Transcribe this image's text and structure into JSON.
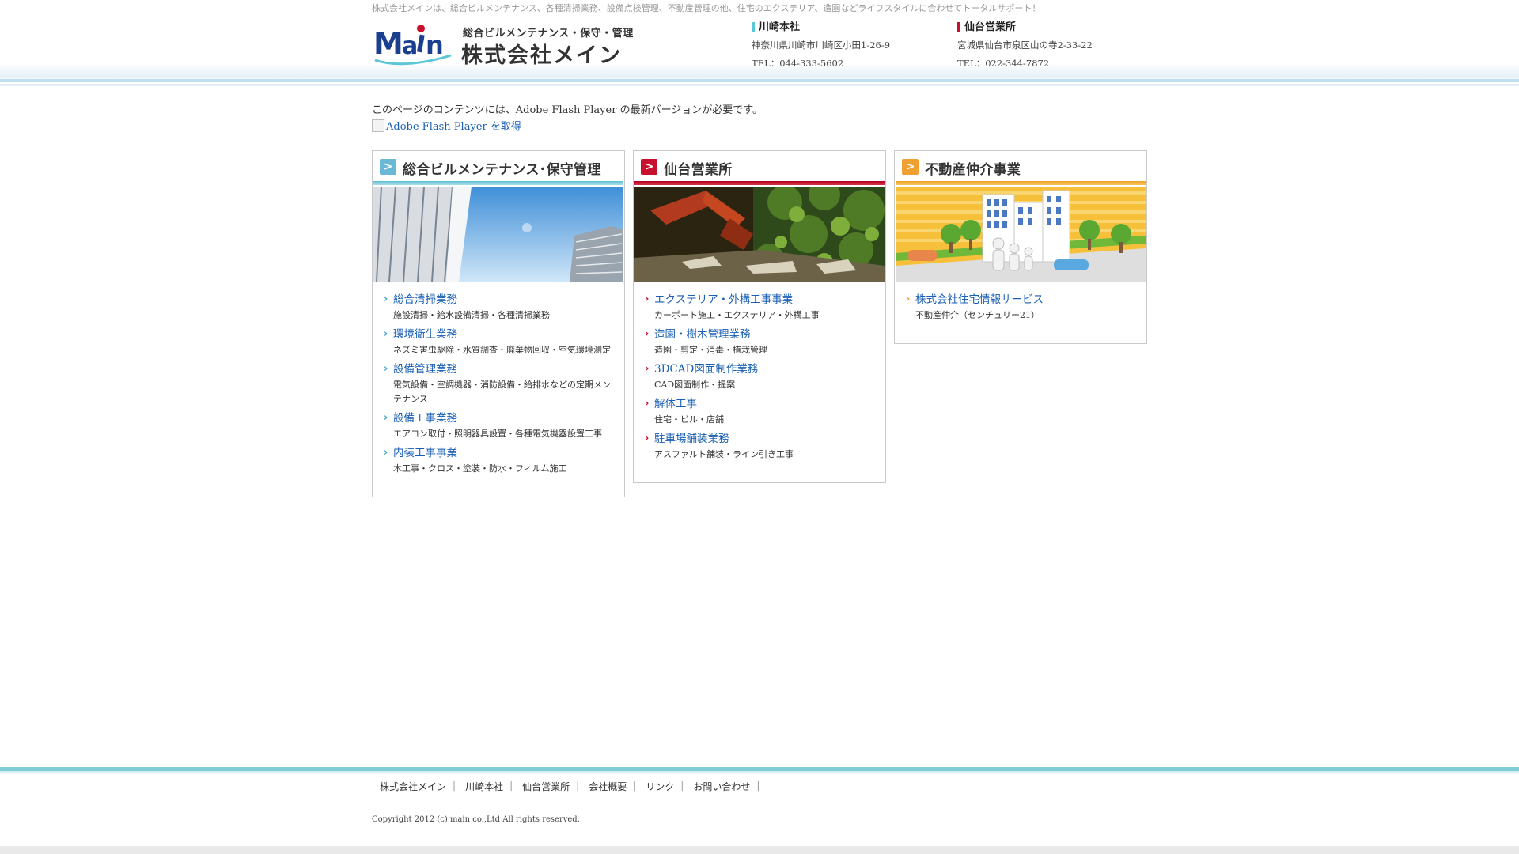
{
  "header": {
    "tagline": "株式会社メインは、総合ビルメンテナンス、各種清掃業務、設備点検管理、不動産管理の他、住宅のエクステリア、造園などライフスタイルに合わせてトータルサポート！",
    "logo_mark_text": "Main",
    "logo_subtitle": "総合ビルメンテナンス・保守・管理",
    "logo_name": "株式会社メイン"
  },
  "offices": [
    {
      "title": "川崎本社",
      "address": "神奈川県川崎市川崎区小田1-26-9",
      "tel": "TEL：044-333-5602",
      "accent": "#5ac6d6"
    },
    {
      "title": "仙台営業所",
      "address": "宮城県仙台市泉区山の寺2-33-22",
      "tel": "TEL：022-344-7872",
      "accent": "#c8102e"
    }
  ],
  "flash": {
    "notice": "このページのコンテンツには、Adobe Flash Player の最新バージョンが必要です。",
    "link_text": "Adobe Flash Player を取得"
  },
  "sections": [
    {
      "title": "総合ビルメンテナンス･保守管理",
      "accent": "#5fc0d3",
      "items": [
        {
          "name": "総合清掃業務",
          "desc": "施設清掃・給水設備清掃・各種清掃業務"
        },
        {
          "name": "環境衛生業務",
          "desc": "ネズミ害虫駆除・水質調査・廃棄物回収・空気環境測定"
        },
        {
          "name": "設備管理業務",
          "desc": "電気設備・空調機器・消防設備・給排水などの定期メンテナンス"
        },
        {
          "name": "設備工事業務",
          "desc": "エアコン取付・照明器具設置・各種電気機器設置工事"
        },
        {
          "name": "内装工事事業",
          "desc": "木工事・クロス・塗装・防水・フィルム施工"
        }
      ]
    },
    {
      "title": "仙台営業所",
      "accent": "#c8102e",
      "items": [
        {
          "name": "エクステリア・外構工事事業",
          "desc": "カーポート施工・エクステリア・外構工事"
        },
        {
          "name": "造園・樹木管理業務",
          "desc": "造園・剪定・消毒・植栽管理"
        },
        {
          "name": "3DCAD図面制作業務",
          "desc": "CAD図面制作・提案"
        },
        {
          "name": "解体工事",
          "desc": "住宅・ビル・店舗"
        },
        {
          "name": "駐車場舗装業務",
          "desc": "アスファルト舗装・ライン引き工事"
        }
      ]
    },
    {
      "title": "不動産仲介事業",
      "accent": "#f0a030",
      "items": [
        {
          "name": "株式会社住宅情報サービス",
          "desc": "不動産仲介（センチュリー21）"
        }
      ]
    }
  ],
  "footer": {
    "nav": [
      "株式会社メイン",
      "川崎本社",
      "仙台営業所",
      "会社概要",
      "リンク",
      "お問い合わせ"
    ],
    "separator": "|",
    "copyright": "Copyright 2012 (c) main co.,Ltd All rights reserved."
  }
}
